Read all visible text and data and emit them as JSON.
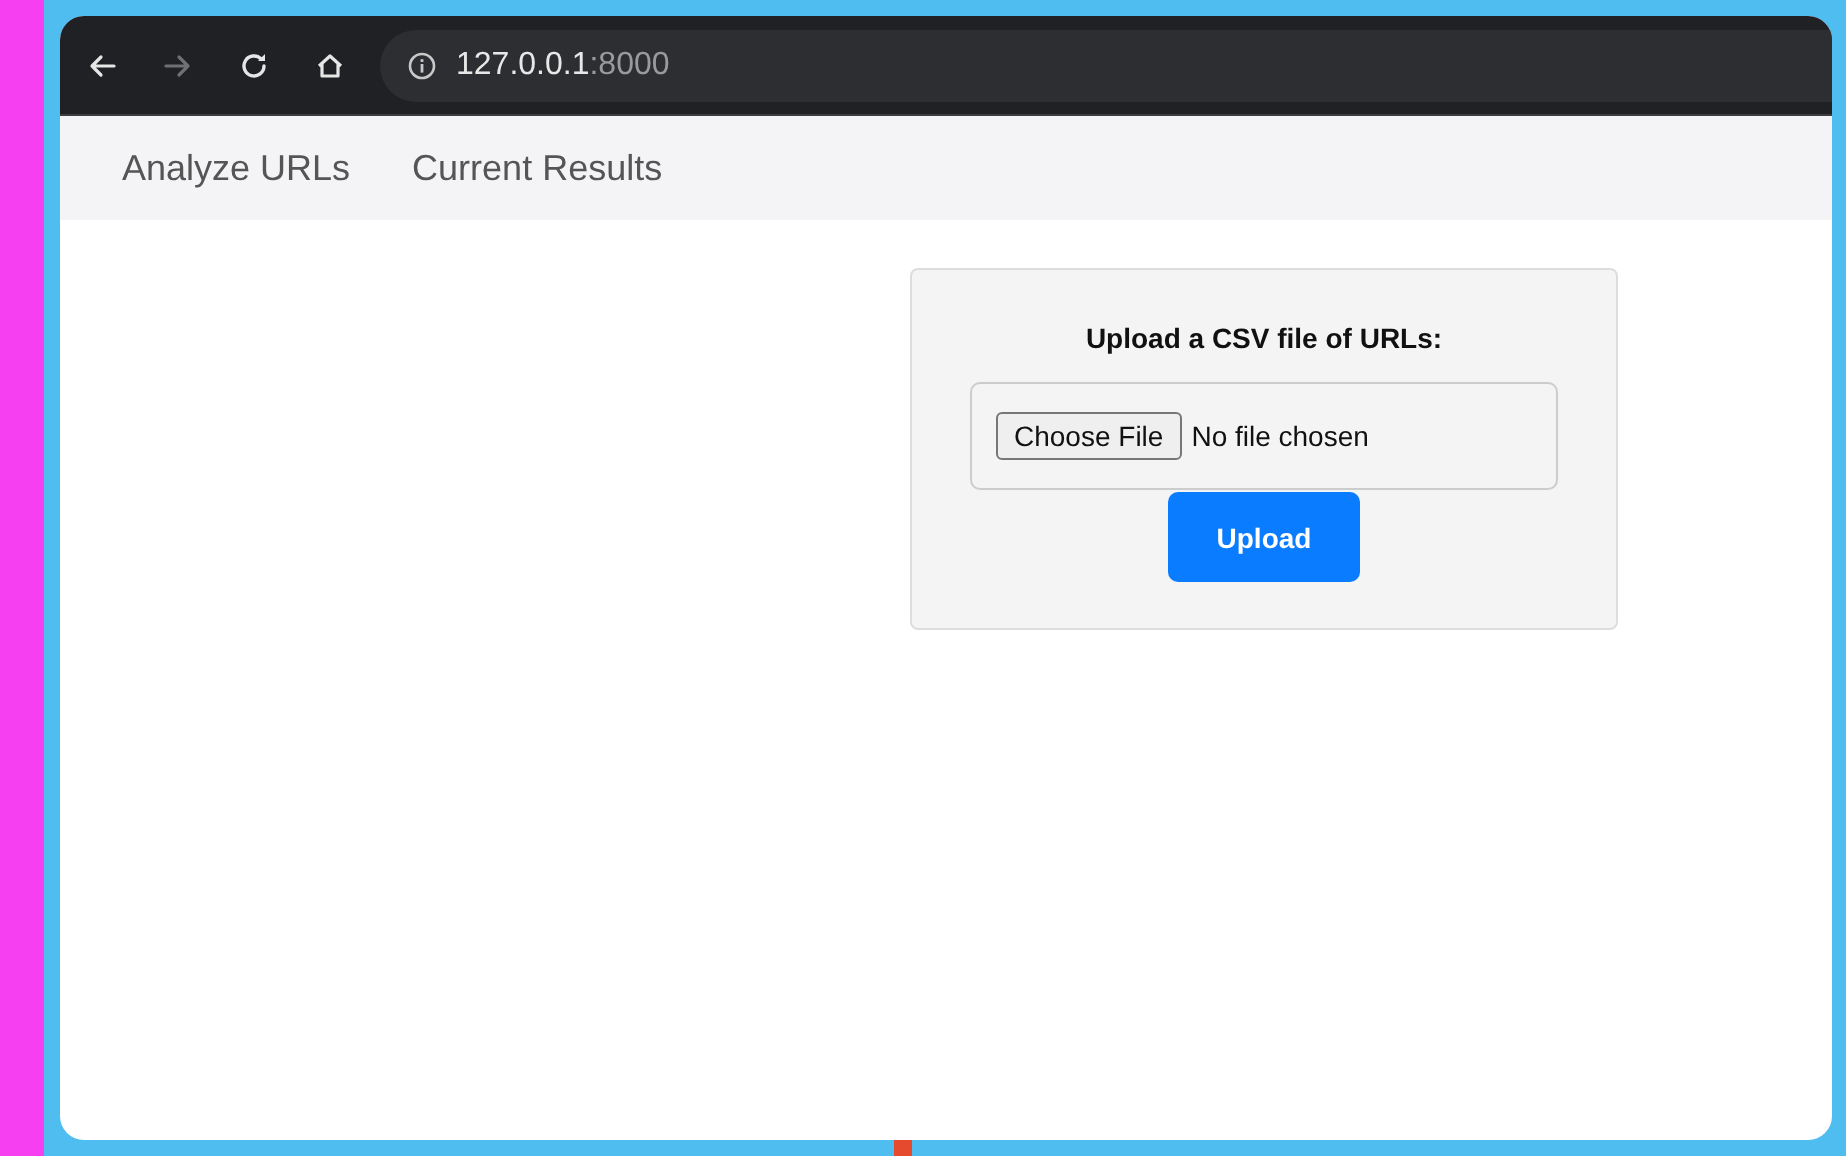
{
  "toolbar": {
    "buttons": [
      {
        "kind": "back",
        "disabled": false
      },
      {
        "kind": "forward",
        "disabled": true
      },
      {
        "kind": "reload",
        "disabled": false
      },
      {
        "kind": "home",
        "disabled": false
      }
    ],
    "address": {
      "host": "127.0.0.1",
      "port": ":8000"
    }
  },
  "nav": {
    "links": [
      "Analyze URLs",
      "Current Results"
    ]
  },
  "upload": {
    "title": "Upload a CSV file of URLs:",
    "choose_button": "Choose File",
    "file_status": "No file chosen",
    "submit": "Upload"
  }
}
